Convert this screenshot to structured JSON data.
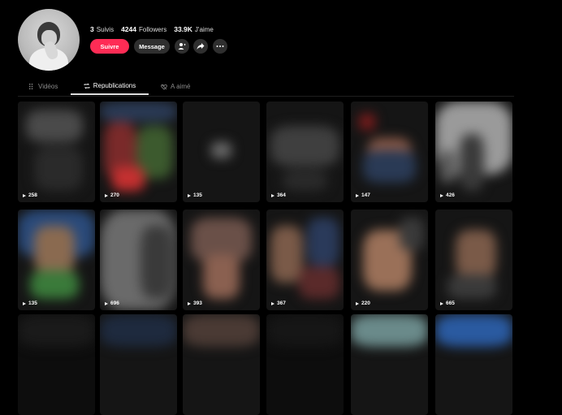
{
  "profile": {
    "following_count": "3",
    "following_label": "Suivis",
    "followers_count": "4244",
    "followers_label": "Followers",
    "likes_count": "33.9K",
    "likes_label": "J'aime",
    "follow_button": "Suivre",
    "message_button": "Message",
    "accent_color": "#fe2c55"
  },
  "tabs": [
    {
      "label": "Vidéos",
      "icon": "grid-icon",
      "active": false
    },
    {
      "label": "Republications",
      "icon": "repost-icon",
      "active": true
    },
    {
      "label": "A aimé",
      "icon": "heart-hidden-icon",
      "active": false
    }
  ],
  "videos": [
    {
      "views": "258"
    },
    {
      "views": "270"
    },
    {
      "views": "135"
    },
    {
      "views": "364"
    },
    {
      "views": "147"
    },
    {
      "views": "426"
    },
    {
      "views": "135"
    },
    {
      "views": "696"
    },
    {
      "views": "393"
    },
    {
      "views": "367"
    },
    {
      "views": "220"
    },
    {
      "views": "665"
    },
    {
      "views": ""
    },
    {
      "views": ""
    },
    {
      "views": ""
    },
    {
      "views": ""
    },
    {
      "views": ""
    },
    {
      "views": ""
    }
  ]
}
